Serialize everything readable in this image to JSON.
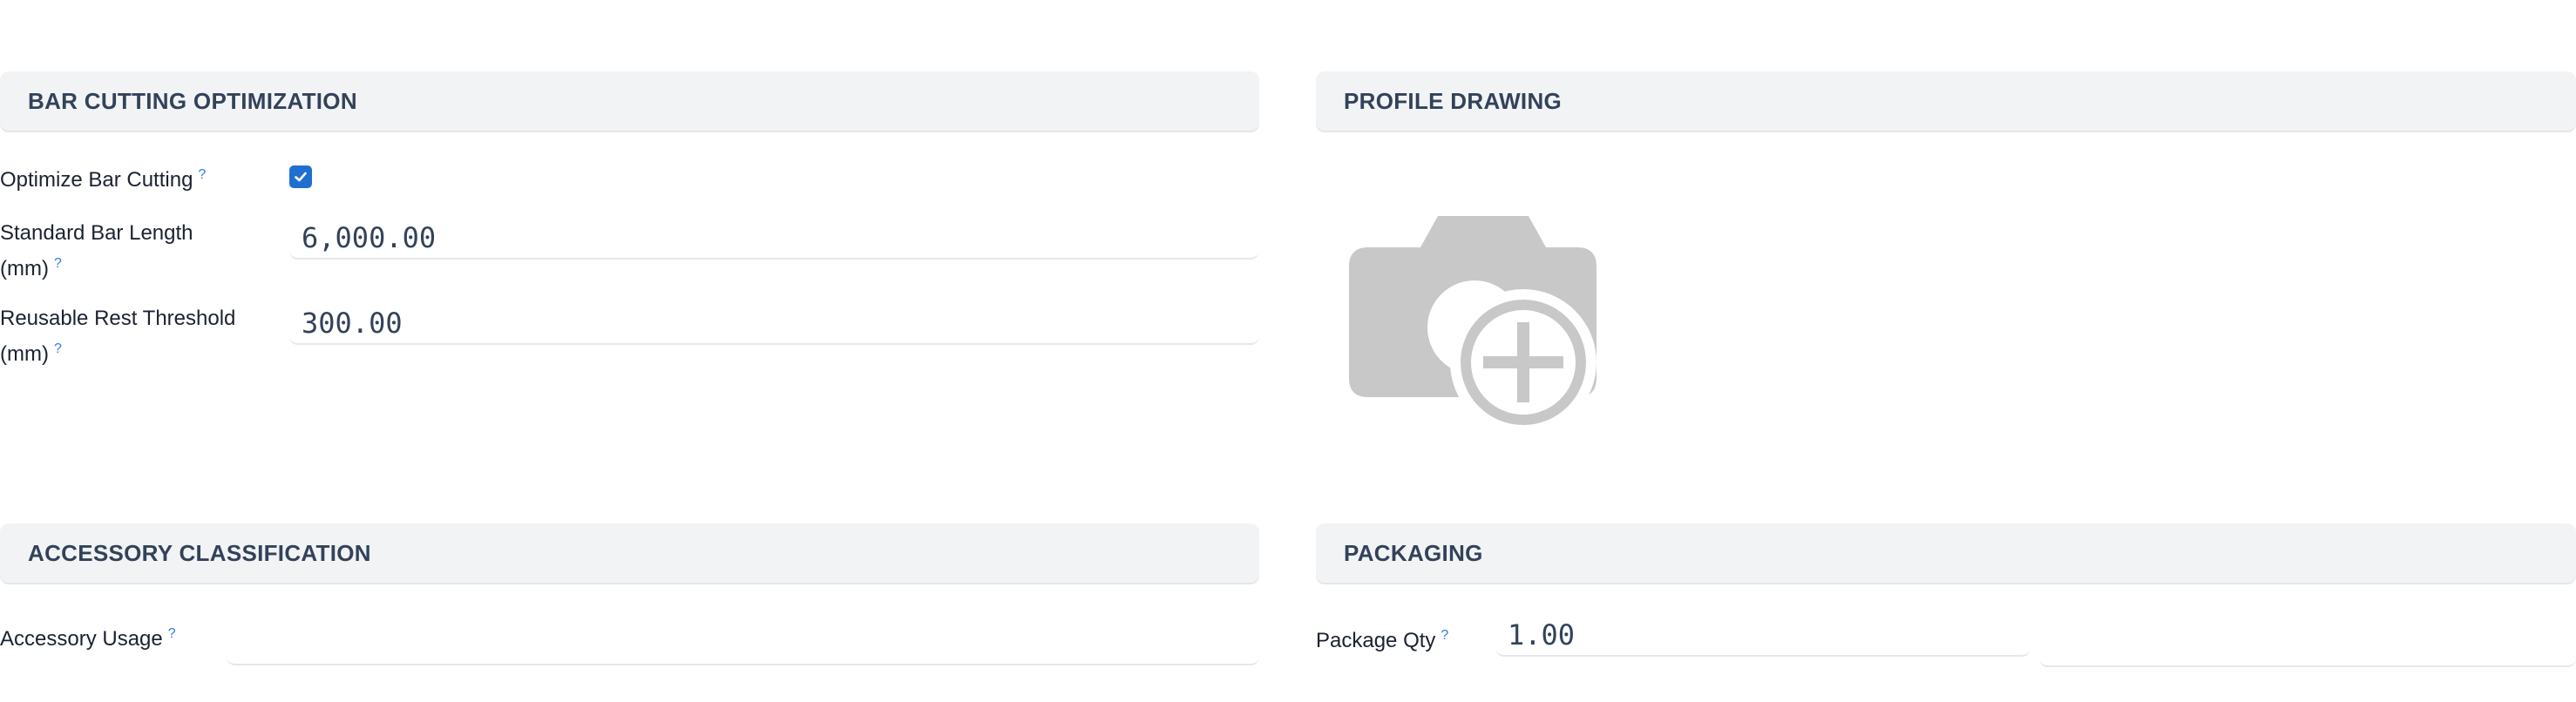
{
  "sections": {
    "bar_cutting": {
      "title": "BAR CUTTING OPTIMIZATION",
      "optimize_label": "Optimize Bar Cutting",
      "optimize_checked": true,
      "bar_length_label_1": "Standard Bar Length",
      "bar_length_label_2": "(mm)",
      "bar_length_value": "6,000.00",
      "rest_threshold_label_1": "Reusable Rest Threshold",
      "rest_threshold_label_2": "(mm)",
      "rest_threshold_value": "300.00"
    },
    "profile_drawing": {
      "title": "PROFILE DRAWING",
      "image_icon": "add-photo-icon"
    },
    "accessory": {
      "title": "ACCESSORY CLASSIFICATION",
      "usage_label": "Accessory Usage",
      "usage_value": ""
    },
    "packaging": {
      "title": "PACKAGING",
      "qty_label": "Package Qty",
      "qty_value": "1.00",
      "unit_value": ""
    }
  },
  "help_marker": "?",
  "colors": {
    "accent": "#1f6fd1",
    "help": "#2a7de1",
    "header_bg": "#f2f3f5",
    "header_text": "#33425a",
    "placeholder_icon": "#c8c8c8"
  }
}
